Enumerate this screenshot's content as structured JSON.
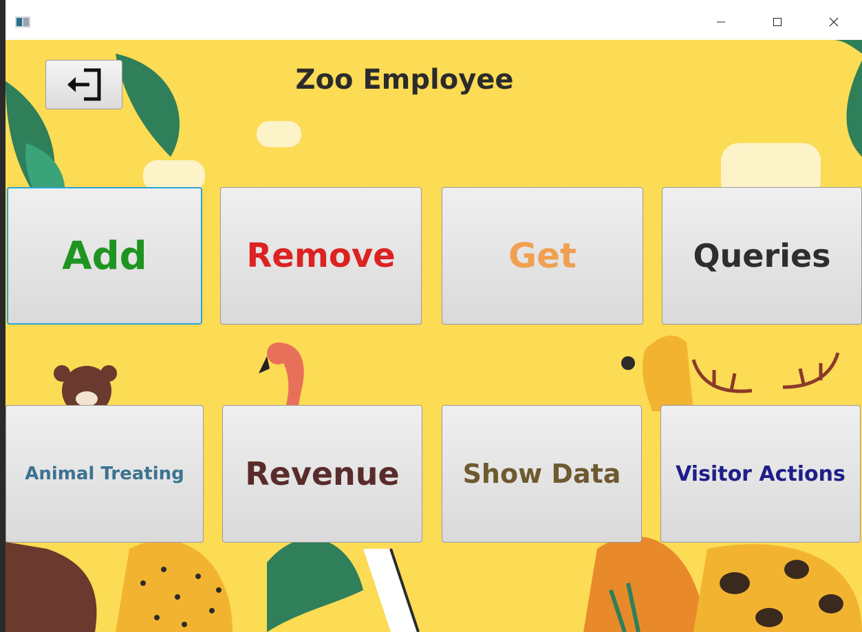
{
  "window": {
    "controls": {
      "minimize_icon": "minimize-icon",
      "maximize_icon": "maximize-icon",
      "close_icon": "close-icon"
    }
  },
  "header": {
    "title": "Zoo Employee",
    "back_icon": "exit-arrow-icon"
  },
  "buttons_row1": [
    {
      "label": "Add",
      "color": "#1f9421"
    },
    {
      "label": "Remove",
      "color": "#dd2222"
    },
    {
      "label": "Get",
      "color": "#f0a050"
    },
    {
      "label": "Queries",
      "color": "#2e2e2e"
    }
  ],
  "buttons_row2": [
    {
      "label": "Animal Treating",
      "color": "#3b7390"
    },
    {
      "label": "Revenue",
      "color": "#5a2b2b"
    },
    {
      "label": "Show Data",
      "color": "#6e5a30"
    },
    {
      "label": "Visitor Actions",
      "color": "#1e1e8a"
    }
  ]
}
